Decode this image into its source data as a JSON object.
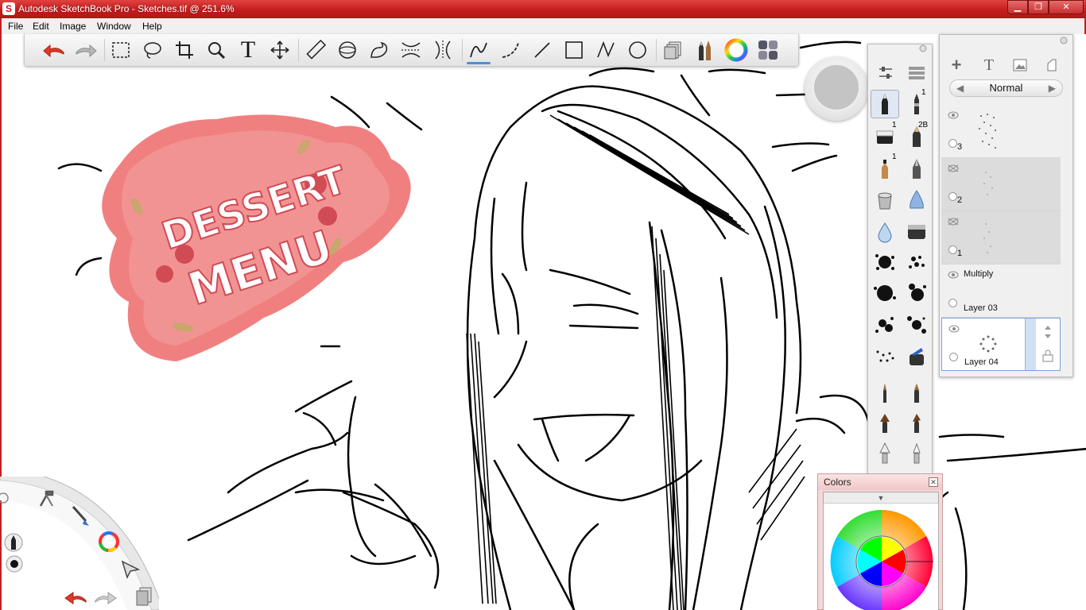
{
  "window": {
    "title": "Autodesk SketchBook Pro - Sketches.tif @ 251.6%",
    "app_icon": "S",
    "min_symbol": "▁",
    "max_symbol": "❐",
    "close_symbol": "✕"
  },
  "menu": {
    "items": [
      "File",
      "Edit",
      "Image",
      "Window",
      "Help"
    ]
  },
  "toolbar": {
    "tools": [
      {
        "name": "undo-icon"
      },
      {
        "name": "redo-icon"
      },
      {
        "name": "rectangle-select-icon"
      },
      {
        "name": "lasso-select-icon"
      },
      {
        "name": "crop-icon"
      },
      {
        "name": "zoom-icon"
      },
      {
        "name": "text-icon"
      },
      {
        "name": "move-icon"
      },
      {
        "name": "ruler-icon"
      },
      {
        "name": "ellipse-guide-icon"
      },
      {
        "name": "french-curve-icon"
      },
      {
        "name": "symmetry-x-icon"
      },
      {
        "name": "symmetry-y-icon"
      },
      {
        "name": "freehand-stroke-icon",
        "active": true
      },
      {
        "name": "curve-stroke-icon"
      },
      {
        "name": "line-icon"
      },
      {
        "name": "rectangle-icon"
      },
      {
        "name": "polyline-icon"
      },
      {
        "name": "circle-icon"
      },
      {
        "name": "layers-icon"
      },
      {
        "name": "brushes-icon"
      },
      {
        "name": "color-wheel-icon"
      },
      {
        "name": "palettes-icon"
      }
    ],
    "text_tool_glyph": "T"
  },
  "colors": {
    "title_bar": "#c41e1e",
    "accent_blue": "#4a90d9",
    "dessert_blob": "#f08080",
    "dessert_dark": "#d14b55",
    "puck_color": "#c4c4c4"
  },
  "brush_palette": {
    "badges": {
      "pencil_size": "1",
      "eraser_size": "1",
      "pencil_grade": "2B",
      "marker_size": "1"
    }
  },
  "layer_editor": {
    "blend_mode": "Normal",
    "prev_arrow": "◀",
    "next_arrow": "▶",
    "text_glyph": "T",
    "add_glyph": "+",
    "layers": [
      {
        "number": "3",
        "visible": true
      },
      {
        "number": "2",
        "visible": false
      },
      {
        "number": "1",
        "visible": false
      },
      {
        "name": "Layer 03",
        "blend": "Multiply",
        "visible": true
      },
      {
        "name": "Layer 04",
        "visible": true,
        "current": true
      }
    ]
  },
  "colors_panel": {
    "title": "Colors",
    "close_symbol": "✕",
    "collapse_symbol": "▼"
  },
  "sketch": {
    "title_line1": "DESSERT",
    "title_line2": "MENU"
  }
}
